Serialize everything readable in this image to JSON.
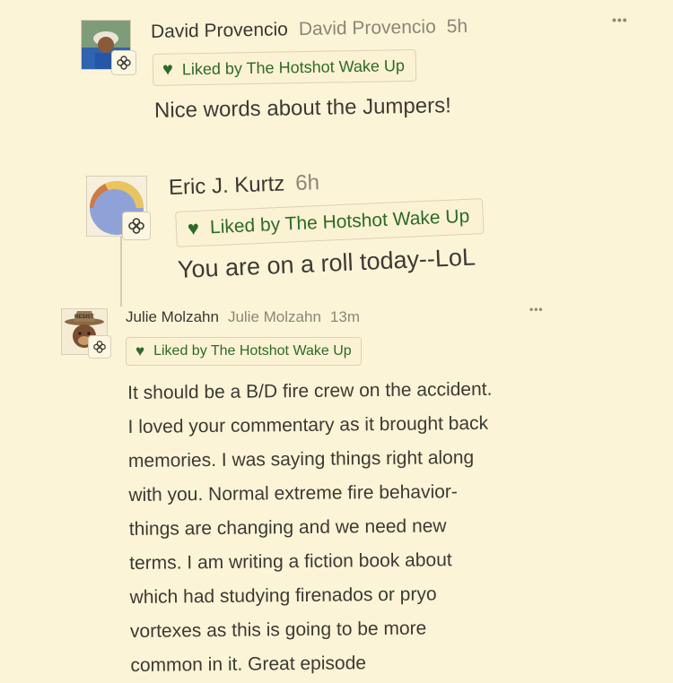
{
  "colors": {
    "background": "#fcf4d7",
    "liked_green": "#2c6a2a",
    "muted_text": "#8d8677"
  },
  "icons": {
    "heart": "♥",
    "more": "•••",
    "badge": "flower-badge-icon"
  },
  "comments": [
    {
      "author": "David Provencio",
      "handle": "David Provencio",
      "time": "5h",
      "liked_label": "Liked by The Hotshot Wake Up",
      "text": "Nice words about the Jumpers!"
    },
    {
      "author": "Eric J. Kurtz",
      "handle": "",
      "time": "6h",
      "liked_label": "Liked by The Hotshot Wake Up",
      "text": "You are on a roll today--LoL"
    },
    {
      "author": "Julie Molzahn",
      "handle": "Julie Molzahn",
      "time": "13m",
      "liked_label": "Liked by The Hotshot Wake Up",
      "avatar_text": "RESIST",
      "lines": [
        "It should be a B/D fire crew on the accident.",
        "I loved your commentary as it brought back",
        "memories. I was saying things right along",
        "with you. Normal extreme fire behavior-",
        "things are changing and we need new",
        "terms. I am writing a fiction book about",
        "which had studying firenados or pryo",
        "vortexes as this is going to be more",
        "common in it. Great episode"
      ]
    }
  ]
}
